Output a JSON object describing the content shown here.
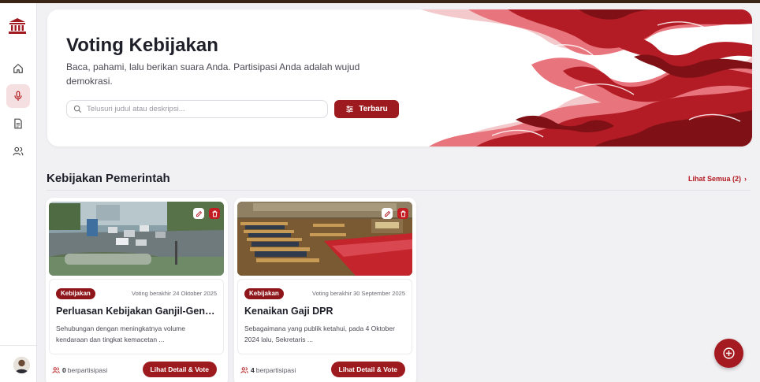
{
  "sidebar": {
    "logo_icon": "parliament-building-icon",
    "items": [
      {
        "name": "home",
        "icon": "home-icon",
        "active": false
      },
      {
        "name": "voting",
        "icon": "microphone-icon",
        "active": true
      },
      {
        "name": "documents",
        "icon": "document-icon",
        "active": false
      },
      {
        "name": "users",
        "icon": "users-icon",
        "active": false
      }
    ],
    "avatar_icon": "user-avatar"
  },
  "hero": {
    "title": "Voting Kebijakan",
    "subtitle": "Baca, pahami, lalu berikan suara Anda. Partisipasi Anda adalah wujud demokrasi.",
    "search_placeholder": "Telusuri judul atau deskripsi...",
    "sort_label": "Terbaru"
  },
  "section": {
    "title": "Kebijakan Pemerintah",
    "see_all": "Lihat Semua (2)"
  },
  "cards": [
    {
      "badge": "Kebijakan",
      "deadline": "Voting berakhir 24 Oktober 2025",
      "title": "Perluasan Kebijakan Ganjil-Genap ...",
      "description": "Sehubungan dengan meningkatnya volume kendaraan dan tingkat kemacetan ...",
      "participants_count": "0",
      "participants_label": "berpartisipasi",
      "button": "Lihat Detail & Vote"
    },
    {
      "badge": "Kebijakan",
      "deadline": "Voting berakhir 30 September 2025",
      "title": "Kenaikan Gaji DPR",
      "description": "Sebagaimana yang publik ketahui, pada 4 Oktober 2024 lalu, Sekretaris ...",
      "participants_count": "4",
      "participants_label": "berpartisipasi",
      "button": "Lihat Detail & Vote"
    }
  ],
  "colors": {
    "primary": "#9d1b1f",
    "badge": "#8e1519",
    "active_nav_bg": "#f6dfe0",
    "background": "#f1f1f4"
  }
}
